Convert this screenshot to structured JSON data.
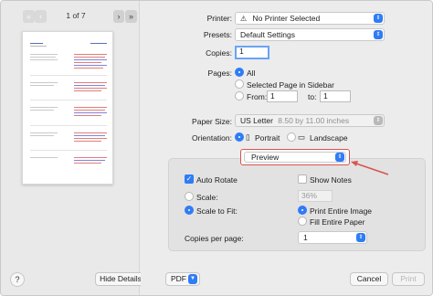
{
  "preview": {
    "page_indicator": "1 of 7",
    "nav_first": "«",
    "nav_prev": "‹",
    "nav_next": "›",
    "nav_last": "»",
    "help_label": "?",
    "hide_details_label": "Hide Details",
    "pdf_label": "PDF"
  },
  "settings": {
    "printer_label": "Printer:",
    "printer_value": "No Printer Selected",
    "presets_label": "Presets:",
    "presets_value": "Default Settings",
    "copies_label": "Copies:",
    "copies_value": "1",
    "pages_label": "Pages:",
    "pages_all": "All",
    "pages_selected": "Selected Page in Sidebar",
    "pages_from_label": "From:",
    "pages_from_value": "1",
    "pages_to_label": "to:",
    "pages_to_value": "1",
    "paper_size_label": "Paper Size:",
    "paper_size_value": "US Letter",
    "paper_size_dims": "8.50 by 11.00 inches",
    "orientation_label": "Orientation:",
    "orientation_portrait": "Portrait",
    "orientation_landscape": "Landscape",
    "section_value": "Preview"
  },
  "preview_panel": {
    "auto_rotate": "Auto Rotate",
    "show_notes": "Show Notes",
    "scale_label": "Scale:",
    "scale_value": "36%",
    "scale_to_fit": "Scale to Fit:",
    "print_entire_image": "Print Entire Image",
    "fill_entire_paper": "Fill Entire Paper",
    "copies_per_page_label": "Copies per page:",
    "copies_per_page_value": "1"
  },
  "footer": {
    "cancel_label": "Cancel",
    "print_label": "Print"
  },
  "colors": {
    "accent": "#2f7cf6",
    "highlight_arrow": "#d9534f"
  }
}
